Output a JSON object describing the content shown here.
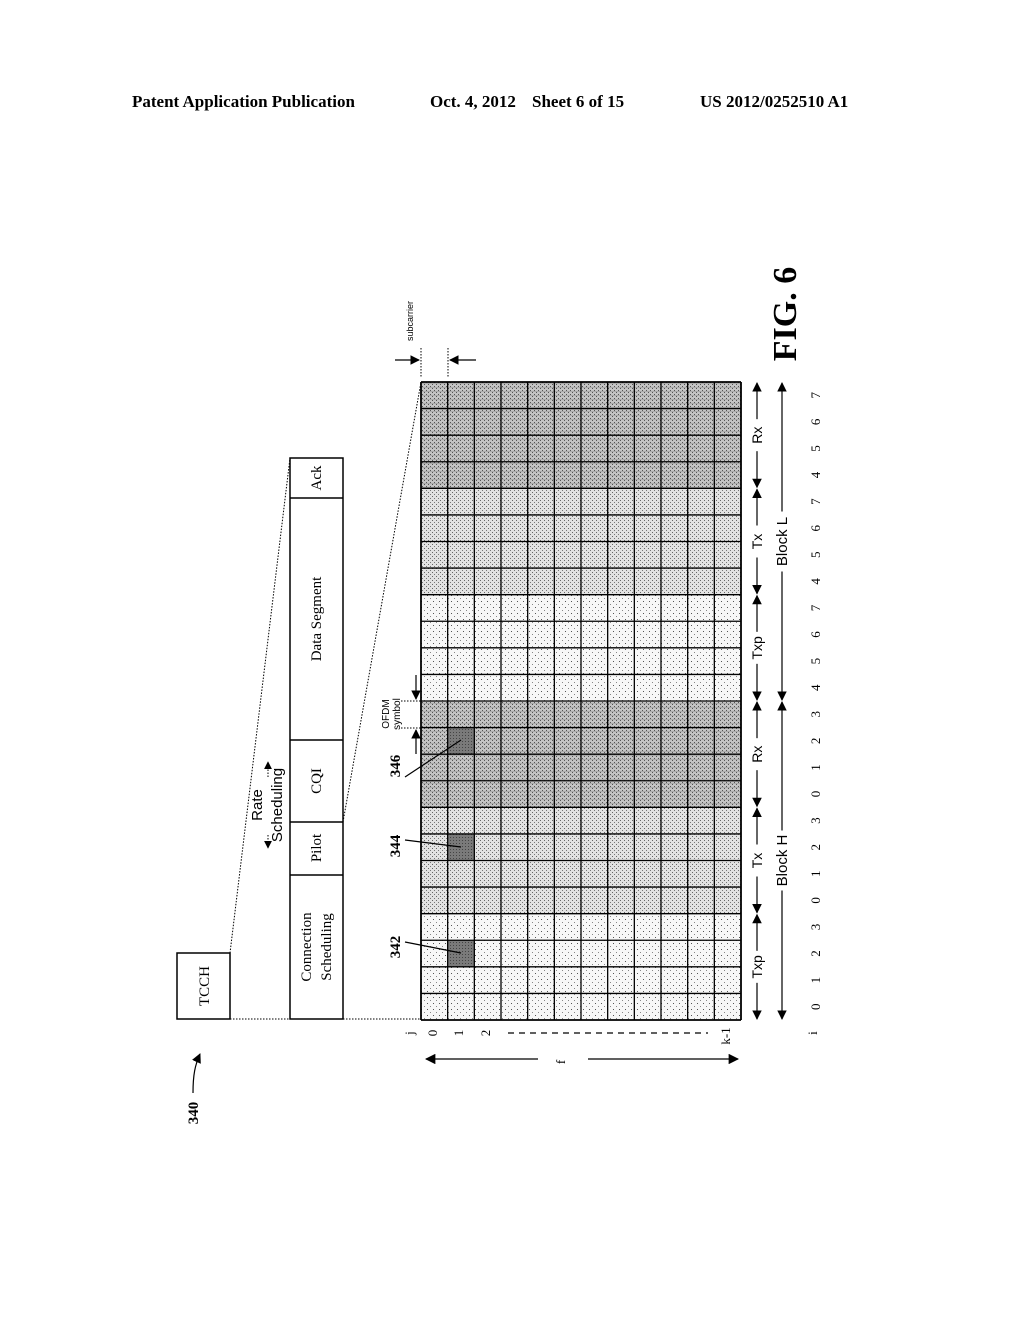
{
  "header": {
    "publication": "Patent Application Publication",
    "date": "Oct. 4, 2012",
    "sheet": "Sheet 6 of 15",
    "number": "US 2012/0252510 A1"
  },
  "figure": {
    "label": "FIG. 6",
    "reference": "340",
    "tcch_label": "TCCH",
    "segments": [
      {
        "name": "connection-scheduling",
        "label_line1": "Connection",
        "label_line2": "Scheduling"
      },
      {
        "name": "pilot",
        "label_line1": "Pilot",
        "label_line2": ""
      },
      {
        "name": "cqi",
        "label_line1": "CQI",
        "label_line2": ""
      },
      {
        "name": "data-segment",
        "label_line1": "Data Segment",
        "label_line2": ""
      },
      {
        "name": "ack",
        "label_line1": "Ack",
        "label_line2": ""
      }
    ],
    "rate_scheduling": {
      "line1": "Rate",
      "line2": "Scheduling"
    },
    "subcarrier_label": "subcarrier",
    "ofdm_symbol_label": {
      "line1": "OFDM",
      "line2": "symbol"
    },
    "grid": {
      "columns": 12,
      "rows_from_top": [
        "Rx",
        "Rx",
        "Rx",
        "Rx",
        "Tx",
        "Tx",
        "Tx",
        "Tx",
        "Txp",
        "Txp",
        "Txp",
        "Txp",
        "Rx",
        "Rx",
        "Rx",
        "Rx",
        "Tx",
        "Tx",
        "Tx",
        "Tx",
        "Txp",
        "Txp",
        "Txp",
        "Txp"
      ],
      "highlighted_cells": [
        {
          "ref": "346",
          "column": 1,
          "row": 13
        },
        {
          "ref": "344",
          "column": 1,
          "row": 17
        },
        {
          "ref": "342",
          "column": 1,
          "row": 21
        }
      ]
    },
    "phase_labels_from_bottom": [
      "Txp",
      "Tx",
      "Rx",
      "Txp",
      "Tx",
      "Rx"
    ],
    "block_labels_from_bottom": [
      "Block H",
      "Block L"
    ],
    "i_axis_label": "i",
    "i_values_from_bottom": [
      "0",
      "1",
      "2",
      "3",
      "0",
      "1",
      "2",
      "3",
      "0",
      "1",
      "2",
      "3",
      "4",
      "5",
      "6",
      "7",
      "4",
      "5",
      "6",
      "7",
      "4",
      "5",
      "6",
      "7"
    ],
    "j_axis_label": "j",
    "j_values": [
      "0",
      "1",
      "2",
      "k-1"
    ],
    "f_axis_label": "f",
    "colors": {
      "ink": "#000000",
      "rx_fill": "#b8b8b8",
      "tx_fill": "#d6d6d6",
      "txp_fill": "#ececec",
      "highlight_fill": "#808080"
    }
  }
}
